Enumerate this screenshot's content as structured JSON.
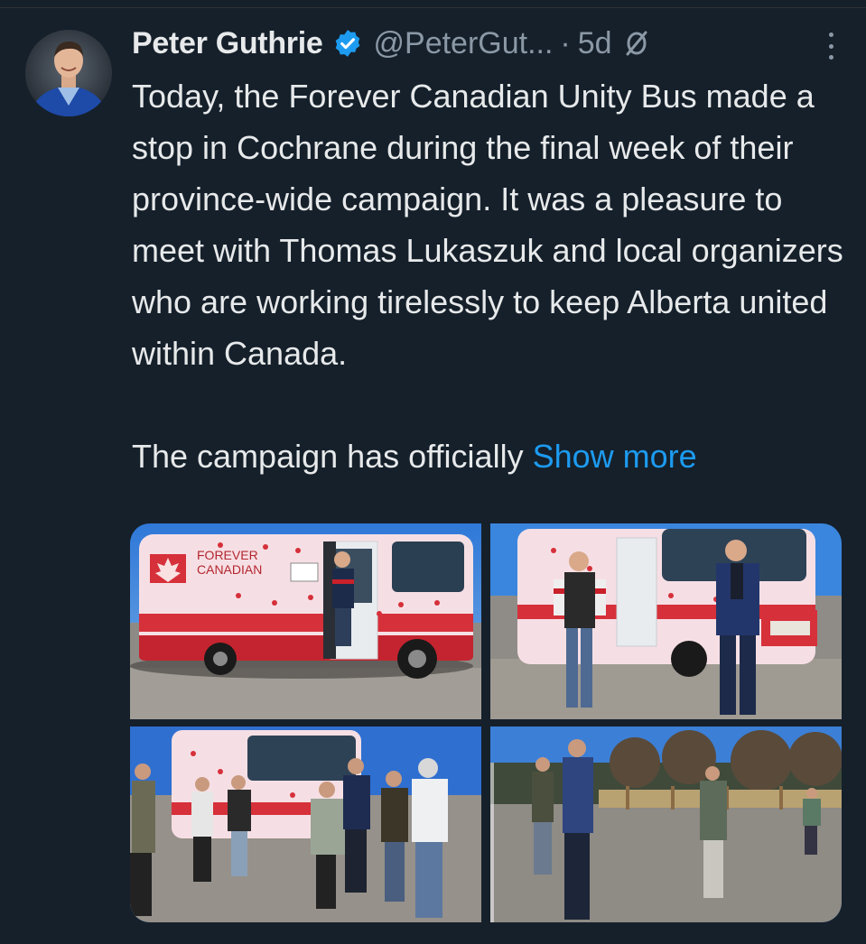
{
  "author": {
    "name": "Peter Guthrie",
    "handle": "@PeterGut...",
    "separator": "·",
    "time": "5d"
  },
  "tweet": {
    "paragraph1": "Today, the Forever Canadian Unity Bus made a stop in Cochrane during the final week of their province-wide campaign. It was a pleasure to meet with Thomas Lukaszuk and local organizers who are working tirelessly to keep Alberta united within Canada.",
    "paragraph2": "The campaign has officially",
    "show_more": "Show more"
  },
  "media": {
    "bus_logo_line1": "FOREVER",
    "bus_logo_line2": "CANADIAN"
  },
  "colors": {
    "background": "#15202b",
    "text": "#e7e9ea",
    "secondary": "#8b98a5",
    "accent": "#1d9bf0",
    "bus_red": "#d6303a",
    "bus_pink": "#f6dfe4"
  },
  "icons": [
    "verified-badge-icon",
    "globe-icon",
    "more-options-icon"
  ]
}
